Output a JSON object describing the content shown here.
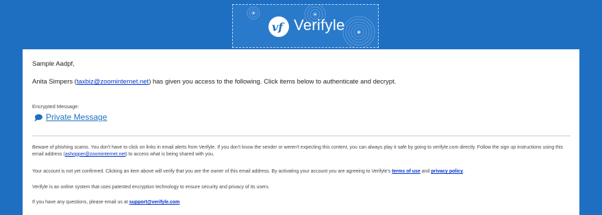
{
  "brand": {
    "logo_mark": "vf",
    "name": "Verifyle",
    "primary_color": "#1e6fc2"
  },
  "email": {
    "greeting": "Sample Aadpf,",
    "intro": {
      "sender_name": "Anita Simpers",
      "open_paren": " (",
      "sender_email": "taxbiz@zoominternet.net",
      "rest": ") has given you access to the following. Click items below to authenticate and decrypt."
    },
    "encrypted_label": "Encrypted Message:",
    "message_link": "Private Message",
    "message_icon": "chat-bubble-icon",
    "phishing": {
      "text1": "Beware of phishing scams. You don't have to click on links in email alerts from Verifyle. If you don't know the sender or weren't expecting this content, you can always play it safe by going to verifyle.com directly. Follow the sign up instructions using this email address (",
      "email": "ashopper@zoominternet.net",
      "text2": ") to access what is being shared with you."
    },
    "account": {
      "text1": "Your account is not yet confirmed. Clicking an item above will verify that you are the owner of this email address. By activating your account you are agreeing to Verifyle's ",
      "terms": "terms of use",
      "and": " and ",
      "privacy": "privacy policy",
      "end": "."
    },
    "about": "Verifyle is an online system that uses patented encryption technology to ensure security and privacy of its users.",
    "questions": {
      "text": "If you have any questions, please email us at ",
      "email": "support@verifyle.com"
    }
  }
}
